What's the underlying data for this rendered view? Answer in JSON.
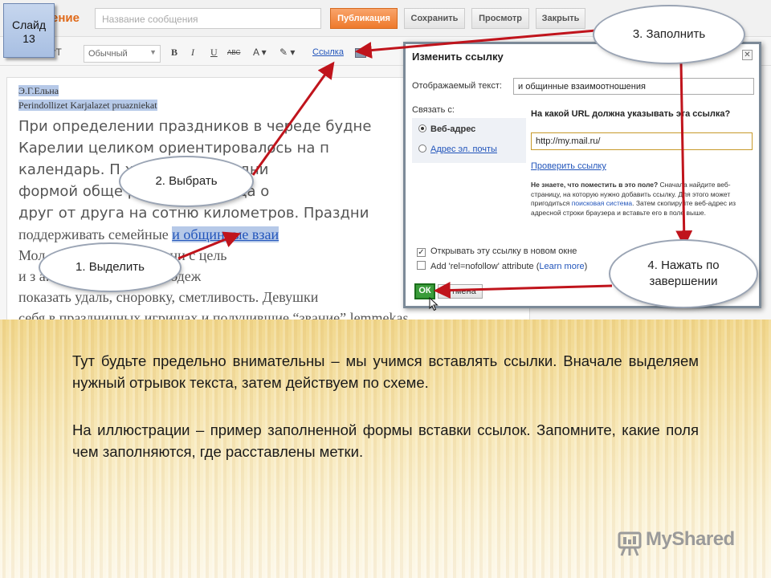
{
  "slide_badge": {
    "line1": "Слайд",
    "line2": "13"
  },
  "editor_app": {
    "heading": "ение",
    "title_placeholder": "Название сообщения",
    "buttons": {
      "publish": "Публикация",
      "save": "Сохранить",
      "preview": "Просмотр",
      "close": "Закрыть"
    },
    "toolbar": {
      "font_size": "тТ",
      "font": "Обычный",
      "bold": "B",
      "italic": "I",
      "underline": "U",
      "strike": "ABC",
      "text_color": "A",
      "link": "Ссылка"
    },
    "content": {
      "author": "Э.Г.Ельна",
      "source": "Perindollizet  Karjalazet  pruazniekat",
      "line1": "При определении праздников в череде будне",
      "line2": "Карелии    целиком ориентировалось на п",
      "line3": "календарь. П                  храмовые праздни",
      "line4": "формой обще                 ревнями, иногда о",
      "line5": "друг от друга на сотню километров. Праздни",
      "line6_a": "поддерживать   семейные   ",
      "line6_link": "и  общинные  взаи",
      "line7": "Мол                      сь в соседние деревни с цель",
      "line8": "и з                  а. На праздниках молодеж",
      "line9": "показать удаль, сноровку, сметливость. Девушки",
      "line10": "себя в праздничных игрищах и получившие “звание” lemmekas"
    }
  },
  "dialog": {
    "title": "Изменить ссылку",
    "close": "✕",
    "text_label": "Отображаемый текст:",
    "text_value": "и общинные взаимоотношения",
    "link_to_label": "Связать с:",
    "radio_web": "Веб-адрес",
    "radio_email": "Адрес эл. почты",
    "question": "На какой URL должна указывать эта ссылка?",
    "url_value": "http://my.mail.ru/",
    "test_link": "Проверить ссылку",
    "hint_q": "Не знаете, что поместить в это поле?",
    "hint_1": " Сначала найдите веб-страницу, на которую нужно добавить ссылку. Для этого может пригодиться ",
    "hint_link": "поисковая система",
    "hint_2": ". Затем скопируйте веб-адрес из адресной строки браузера и вставьте его в поле выше.",
    "cb_newwin": "Открывать эту ссылку в новом окне",
    "cb_nofollow_a": "Add 'rel=nofollow' attribute (",
    "cb_nofollow_link": "Learn more",
    "cb_nofollow_b": ")",
    "ok": "ОК",
    "cancel": "Отмена"
  },
  "callouts": {
    "step1": "1. Выделить",
    "step2": "2. Выбрать",
    "step3": "3. Заполнить",
    "step4_a": "4. Нажать по",
    "step4_b": "завершении"
  },
  "instructions": {
    "para1": "Тут будьте предельно внимательны – мы учимся вставлять ссылки. Вначале выделяем нужный отрывок текста, затем действуем по схеме.",
    "para2": "На иллюстрации – пример заполненной формы вставки ссылок. Запомните, какие поля чем заполняются, где расставлены метки."
  },
  "watermark": "MyShared",
  "colors": {
    "arrow": "#c0141c",
    "publish": "#ee7a2c",
    "link": "#2255bb",
    "ok": "#3a9c3a"
  }
}
